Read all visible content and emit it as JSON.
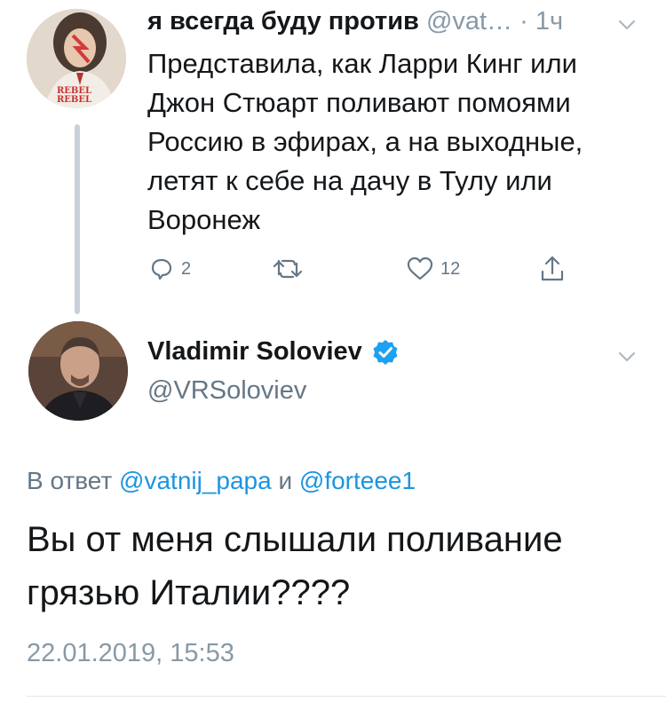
{
  "parent_tweet": {
    "name": "я всегда буду против",
    "handle": "@vat…",
    "separator": "·",
    "time": "1ч",
    "text": "Представила, как Ларри Кинг или Джон Стюарт поливают помоями Россию в эфирах, а на выходные, летят к себе на дачу в Тулу или Воронеж",
    "avatar_badge": "REBEL REBEL",
    "actions": {
      "reply_count": "2",
      "retweet_count": "",
      "like_count": "12"
    }
  },
  "main_tweet": {
    "name": "Vladimir Soloviev",
    "handle": "@VRSoloviev",
    "reply_prefix": "В ответ",
    "reply_user_1": "@vatnij_papa",
    "reply_conjunction": "и",
    "reply_user_2": "@forteee1",
    "text": "Вы от меня слышали поливание грязью Италии????",
    "timestamp": "22.01.2019, 15:53"
  },
  "colors": {
    "accent": "#1b95e0",
    "muted": "#8899a6",
    "thread_line": "#c8d1d9"
  }
}
